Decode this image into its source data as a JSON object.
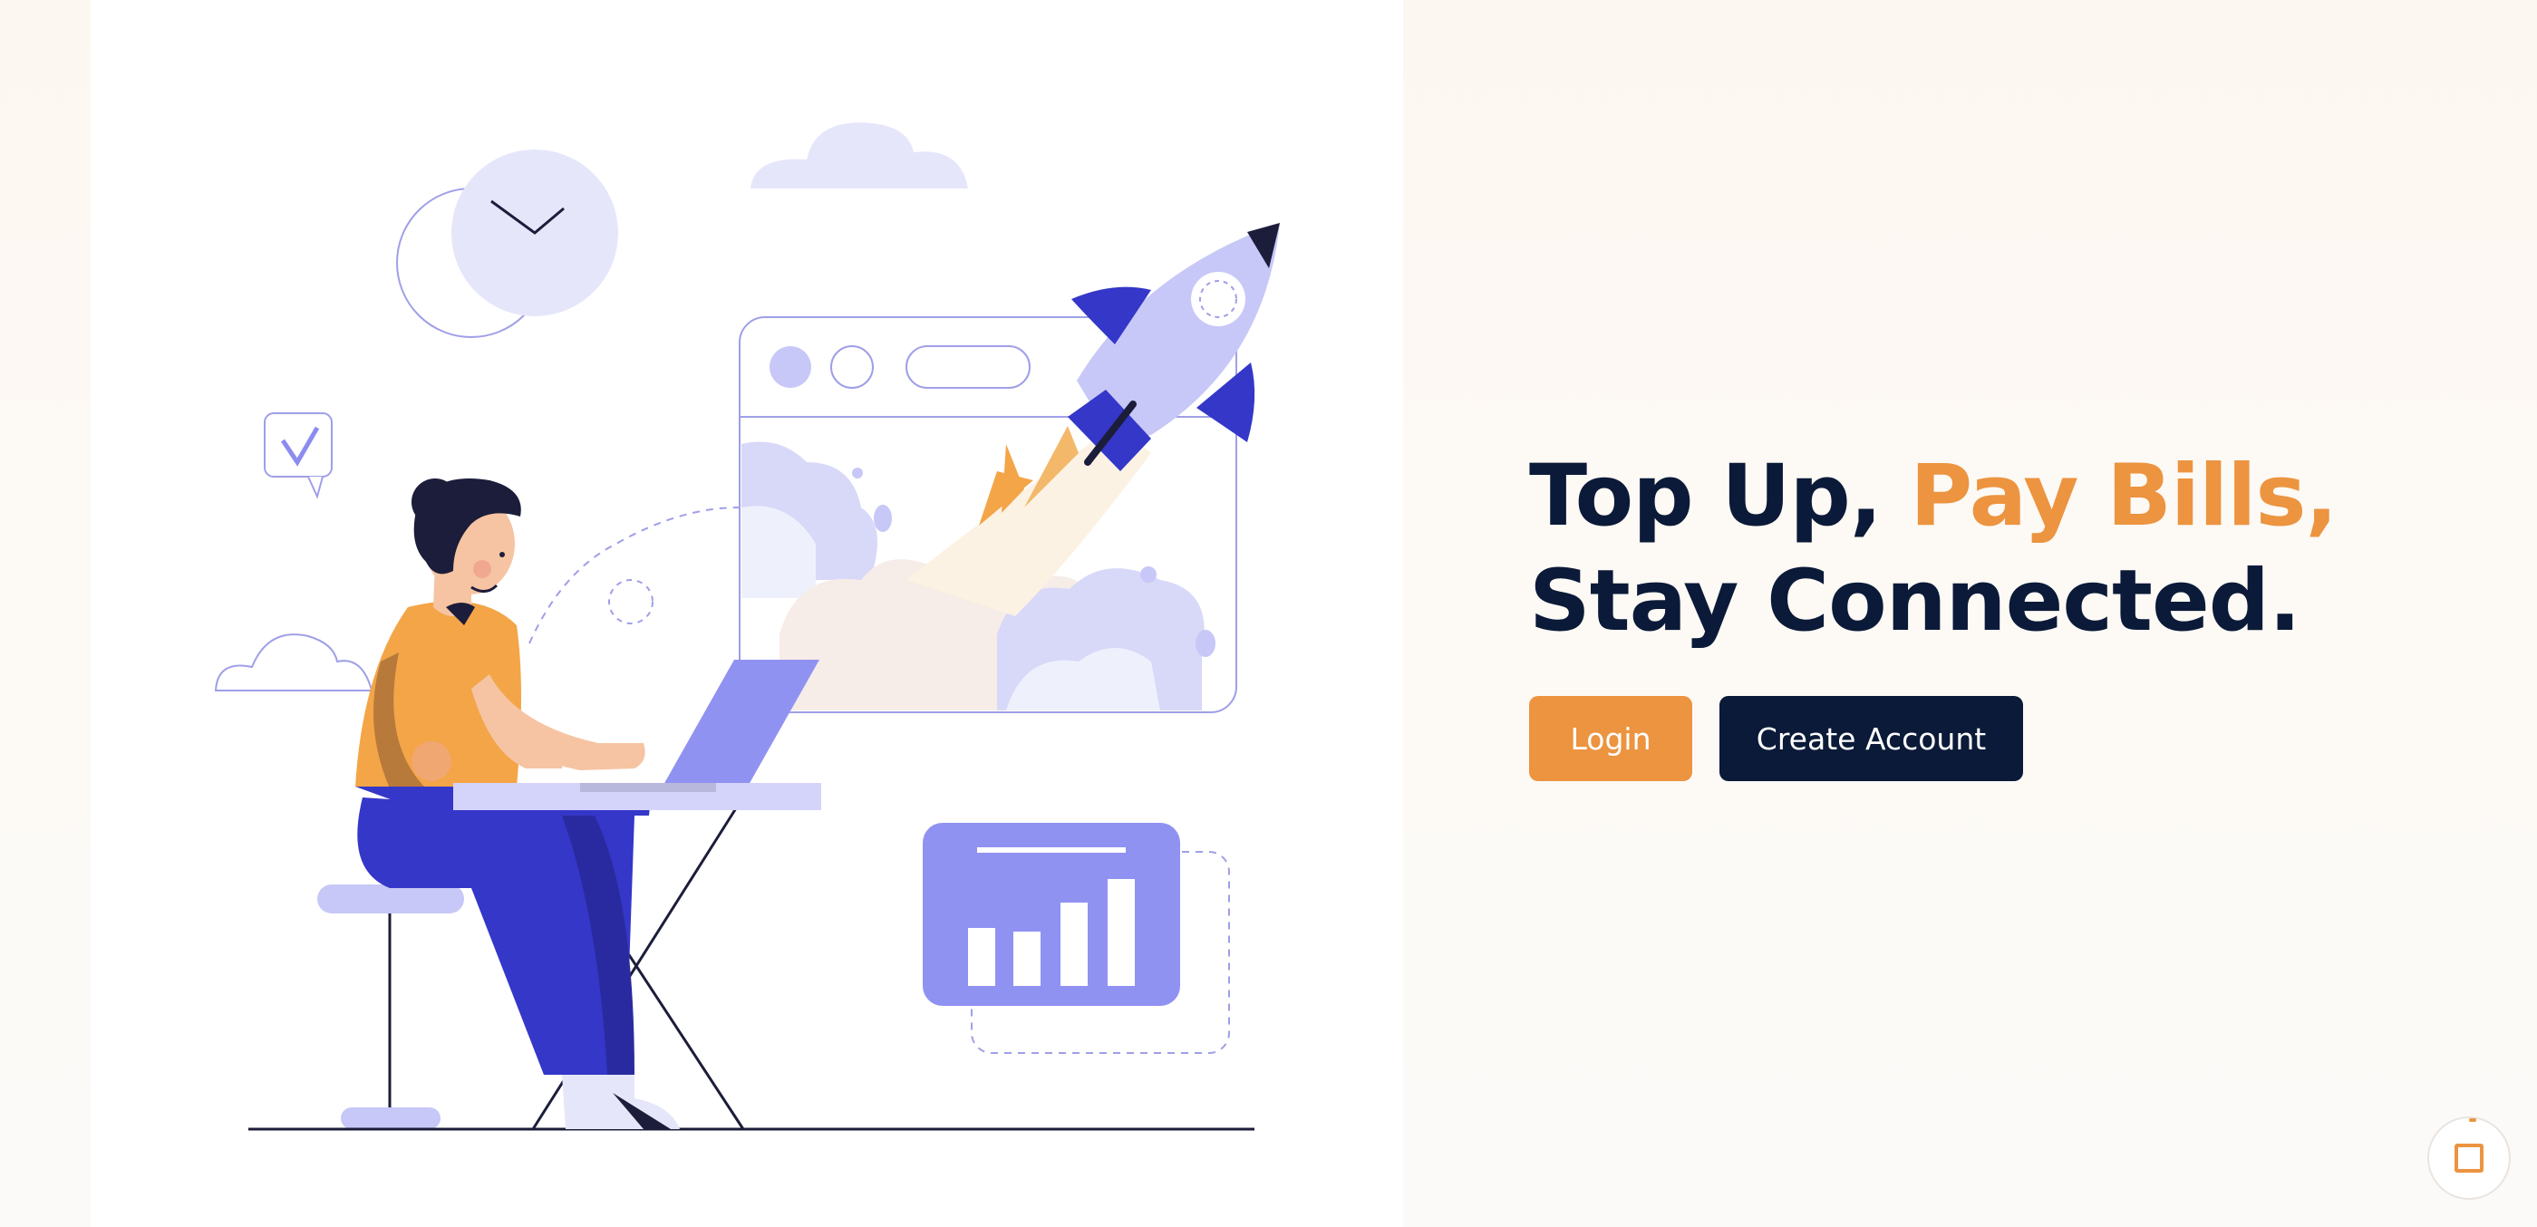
{
  "hero": {
    "headline_line1_prefix": "Top Up, ",
    "headline_line1_accent": "Pay Bills,",
    "headline_line2": "Stay Connected.",
    "illustration": "person-with-laptop-rocket-launch-illustration"
  },
  "actions": {
    "login_label": "Login",
    "create_account_label": "Create Account"
  },
  "floating_button": {
    "icon": "square-icon"
  },
  "colors": {
    "accent": "#ec9440",
    "navy": "#0b1a38",
    "lavender": "#c7c8f7",
    "indigo": "#3437c8",
    "background": "#fdf8f3"
  }
}
